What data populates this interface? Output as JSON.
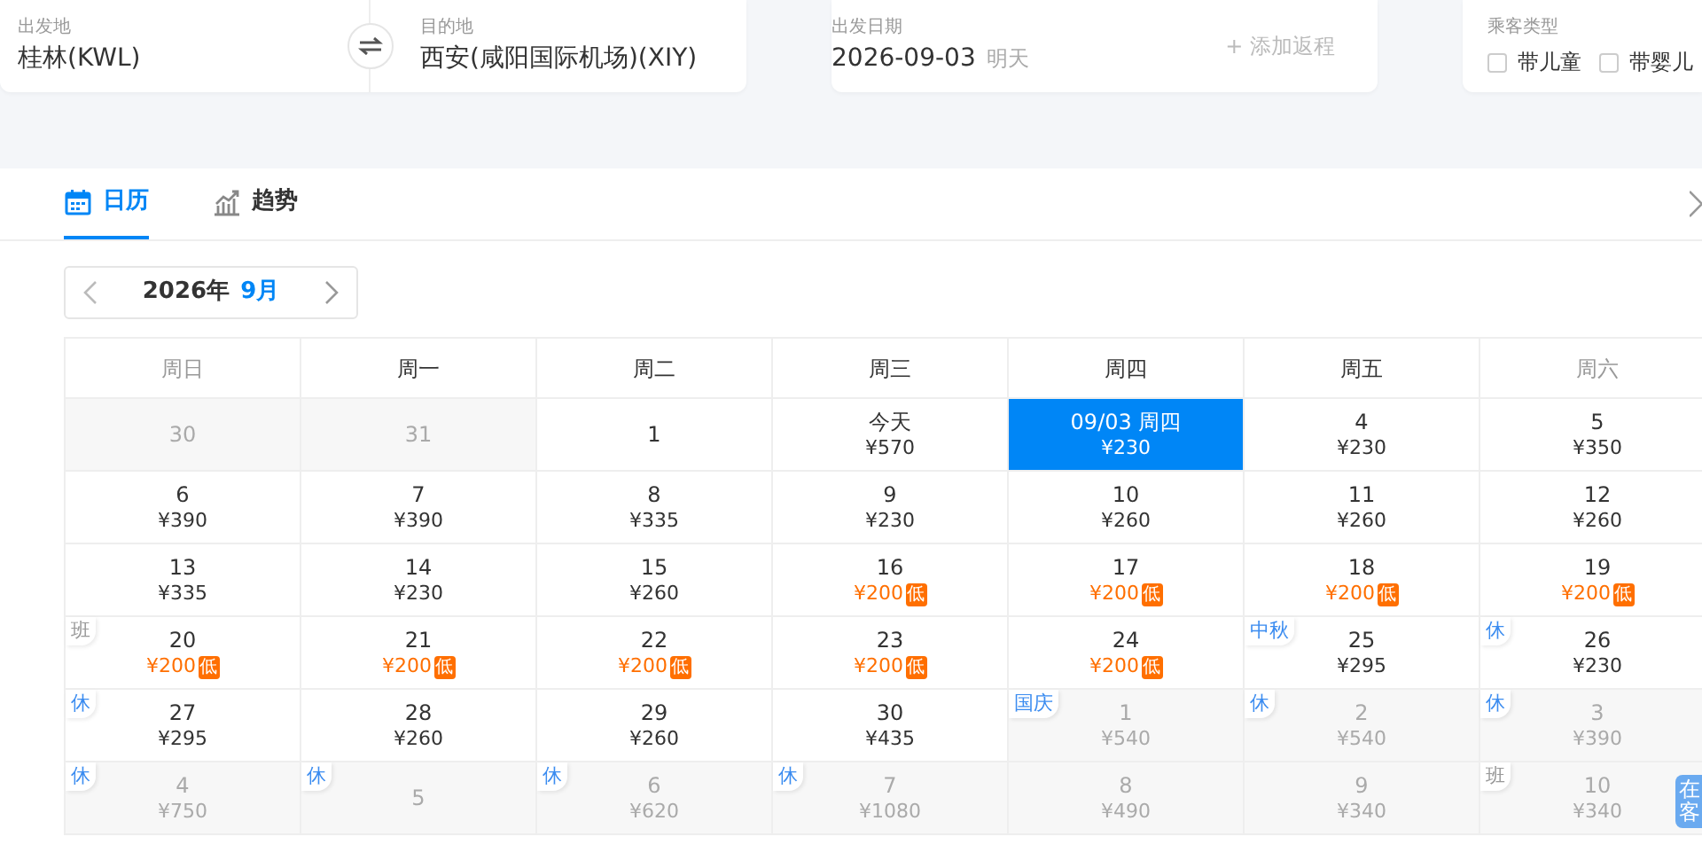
{
  "search": {
    "from": {
      "label": "出发地",
      "value": "桂林(KWL)"
    },
    "to": {
      "label": "目的地",
      "value": "西安(咸阳国际机场)(XIY)"
    },
    "date": {
      "label": "出发日期",
      "value": "2026-09-03",
      "hint": "明天",
      "return_link": "+ 添加返程"
    },
    "passengers": {
      "label": "乘客类型",
      "options": [
        {
          "label": "带儿童",
          "checked": false
        },
        {
          "label": "带婴儿",
          "checked": false
        }
      ]
    }
  },
  "tabs": [
    {
      "label": "日历",
      "selected": true
    },
    {
      "label": "趋势",
      "selected": false
    }
  ],
  "month_picker": {
    "year": "2026年",
    "month": "9月"
  },
  "weekdays": [
    {
      "label": "周日",
      "weekend": true
    },
    {
      "label": "周一",
      "weekend": false
    },
    {
      "label": "周二",
      "weekend": false
    },
    {
      "label": "周三",
      "weekend": false
    },
    {
      "label": "周四",
      "weekend": false
    },
    {
      "label": "周五",
      "weekend": false
    },
    {
      "label": "周六",
      "weekend": true
    }
  ],
  "weeks": [
    [
      {
        "day": "30",
        "out_of_month": true,
        "selected": false
      },
      {
        "day": "31",
        "out_of_month": true,
        "selected": false
      },
      {
        "day": "1",
        "out_of_month": false,
        "selected": false
      },
      {
        "day": "今天",
        "price": "¥570",
        "out_of_month": false,
        "selected": false
      },
      {
        "day": "09/03 周四",
        "price": "¥230",
        "out_of_month": false,
        "selected": true
      },
      {
        "day": "4",
        "price": "¥230",
        "out_of_month": false,
        "selected": false
      },
      {
        "day": "5",
        "price": "¥350",
        "out_of_month": false,
        "selected": false
      }
    ],
    [
      {
        "day": "6",
        "price": "¥390",
        "out_of_month": false,
        "selected": false
      },
      {
        "day": "7",
        "price": "¥390",
        "out_of_month": false,
        "selected": false
      },
      {
        "day": "8",
        "price": "¥335",
        "out_of_month": false,
        "selected": false
      },
      {
        "day": "9",
        "price": "¥230",
        "out_of_month": false,
        "selected": false
      },
      {
        "day": "10",
        "price": "¥260",
        "out_of_month": false,
        "selected": false
      },
      {
        "day": "11",
        "price": "¥260",
        "out_of_month": false,
        "selected": false
      },
      {
        "day": "12",
        "price": "¥260",
        "out_of_month": false,
        "selected": false
      }
    ],
    [
      {
        "day": "13",
        "price": "¥335",
        "out_of_month": false,
        "selected": false
      },
      {
        "day": "14",
        "price": "¥230",
        "out_of_month": false,
        "selected": false
      },
      {
        "day": "15",
        "price": "¥260",
        "out_of_month": false,
        "selected": false
      },
      {
        "day": "16",
        "price": "¥200",
        "low": "低",
        "out_of_month": false,
        "selected": false
      },
      {
        "day": "17",
        "price": "¥200",
        "low": "低",
        "out_of_month": false,
        "selected": false
      },
      {
        "day": "18",
        "price": "¥200",
        "low": "低",
        "out_of_month": false,
        "selected": false
      },
      {
        "day": "19",
        "price": "¥200",
        "low": "低",
        "out_of_month": false,
        "selected": false
      }
    ],
    [
      {
        "day": "20",
        "price": "¥200",
        "low": "低",
        "tag": {
          "text": "班",
          "kind": "work"
        },
        "out_of_month": false,
        "selected": false
      },
      {
        "day": "21",
        "price": "¥200",
        "low": "低",
        "out_of_month": false,
        "selected": false
      },
      {
        "day": "22",
        "price": "¥200",
        "low": "低",
        "out_of_month": false,
        "selected": false
      },
      {
        "day": "23",
        "price": "¥200",
        "low": "低",
        "out_of_month": false,
        "selected": false
      },
      {
        "day": "24",
        "price": "¥200",
        "low": "低",
        "out_of_month": false,
        "selected": false
      },
      {
        "day": "25",
        "price": "¥295",
        "tag": {
          "text": "中秋",
          "kind": "holiday"
        },
        "out_of_month": false,
        "selected": false
      },
      {
        "day": "26",
        "price": "¥230",
        "tag": {
          "text": "休",
          "kind": "holiday"
        },
        "out_of_month": false,
        "selected": false
      }
    ],
    [
      {
        "day": "27",
        "price": "¥295",
        "tag": {
          "text": "休",
          "kind": "holiday"
        },
        "out_of_month": false,
        "selected": false
      },
      {
        "day": "28",
        "price": "¥260",
        "out_of_month": false,
        "selected": false
      },
      {
        "day": "29",
        "price": "¥260",
        "out_of_month": false,
        "selected": false
      },
      {
        "day": "30",
        "price": "¥435",
        "out_of_month": false,
        "selected": false
      },
      {
        "day": "1",
        "price": "¥540",
        "tag": {
          "text": "国庆",
          "kind": "holiday"
        },
        "out_of_month": true,
        "selected": false
      },
      {
        "day": "2",
        "price": "¥540",
        "tag": {
          "text": "休",
          "kind": "holiday"
        },
        "out_of_month": true,
        "selected": false
      },
      {
        "day": "3",
        "price": "¥390",
        "tag": {
          "text": "休",
          "kind": "holiday"
        },
        "out_of_month": true,
        "selected": false
      }
    ],
    [
      {
        "day": "4",
        "price": "¥750",
        "tag": {
          "text": "休",
          "kind": "holiday"
        },
        "out_of_month": true,
        "selected": false
      },
      {
        "day": "5",
        "tag": {
          "text": "休",
          "kind": "holiday"
        },
        "out_of_month": true,
        "selected": false
      },
      {
        "day": "6",
        "price": "¥620",
        "tag": {
          "text": "休",
          "kind": "holiday"
        },
        "out_of_month": true,
        "selected": false
      },
      {
        "day": "7",
        "price": "¥1080",
        "tag": {
          "text": "休",
          "kind": "holiday"
        },
        "out_of_month": true,
        "selected": false
      },
      {
        "day": "8",
        "price": "¥490",
        "out_of_month": true,
        "selected": false
      },
      {
        "day": "9",
        "price": "¥340",
        "out_of_month": true,
        "selected": false
      },
      {
        "day": "10",
        "price": "¥340",
        "tag": {
          "text": "班",
          "kind": "work"
        },
        "out_of_month": true,
        "selected": false
      }
    ]
  ],
  "service_button": "在客"
}
